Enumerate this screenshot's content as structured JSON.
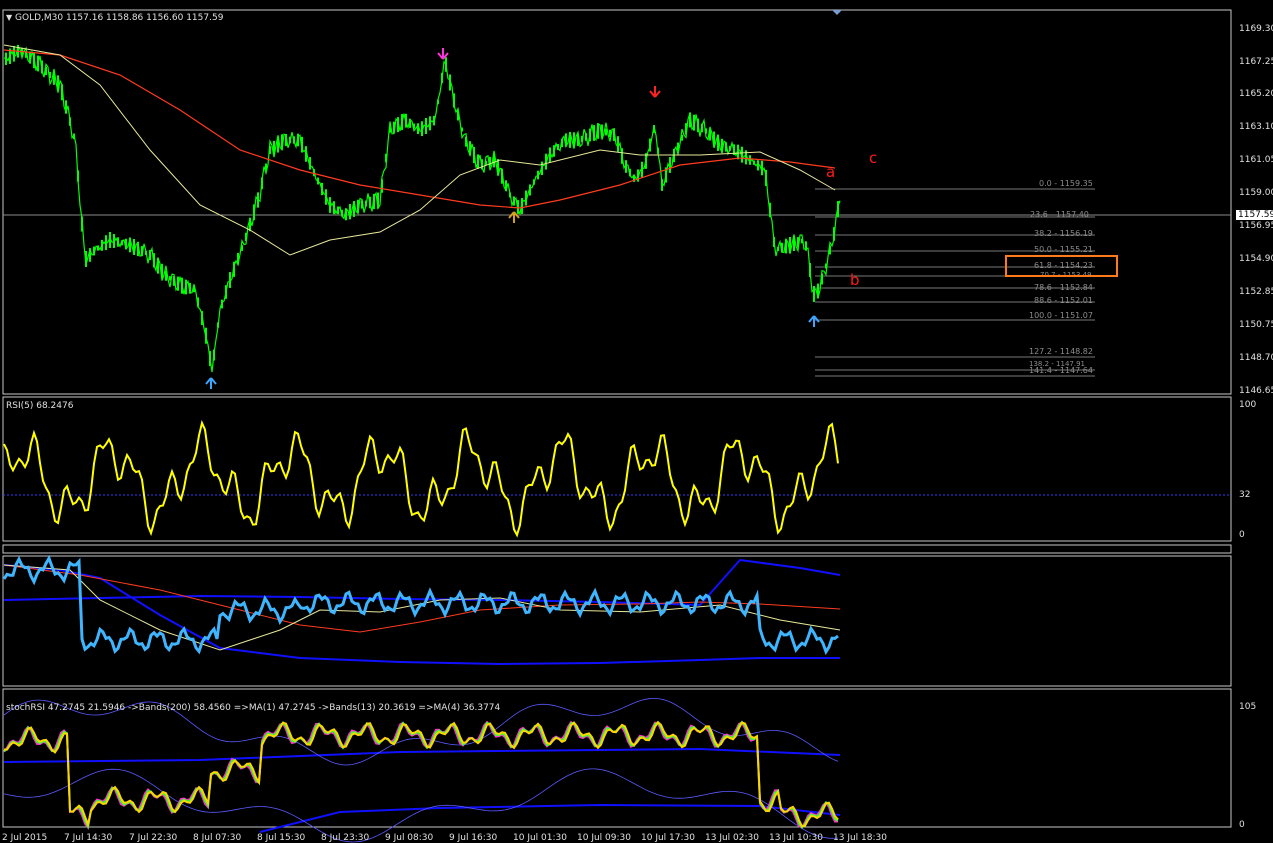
{
  "symbol_header": "GOLD,M30  1157.16 1158.86 1156.60 1157.59",
  "rsi_header": "RSI(5) 68.2476",
  "stoch_header": "stochRSI 47.2745 21.5946  ->Bands(200) 58.4560  =>MA(1) 47.2745  ->Bands(13) 20.3619  =>MA(4) 36.3774",
  "current_price": "1157.59",
  "price_axis": [
    "1169.30",
    "1167.25",
    "1165.20",
    "1163.10",
    "1161.05",
    "1159.00",
    "1156.95",
    "1154.90",
    "1152.85",
    "1150.75",
    "1148.70",
    "1146.65"
  ],
  "rsi_axis": [
    "100",
    "32",
    "0"
  ],
  "stoch_axis": [
    "105",
    "0"
  ],
  "time_axis": [
    "2 Jul 2015",
    "7 Jul 14:30",
    "7 Jul 22:30",
    "8 Jul 07:30",
    "8 Jul 15:30",
    "8 Jul 23:30",
    "9 Jul 08:30",
    "9 Jul 16:30",
    "10 Jul 01:30",
    "10 Jul 09:30",
    "10 Jul 17:30",
    "13 Jul 02:30",
    "13 Jul 10:30",
    "13 Jul 18:30"
  ],
  "fib_levels": [
    {
      "ratio": "0.0",
      "price": "1159.35"
    },
    {
      "ratio": "23.6",
      "price": "1157.40"
    },
    {
      "ratio": "38.2",
      "price": "1156.19"
    },
    {
      "ratio": "50.0",
      "price": "1155.21"
    },
    {
      "ratio": "61.8",
      "price": "1154.23"
    },
    {
      "ratio": "70.7",
      "price": "1153.49"
    },
    {
      "ratio": "78.6",
      "price": "1152.84"
    },
    {
      "ratio": "88.6",
      "price": "1152.01"
    },
    {
      "ratio": "100.0",
      "price": "1151.07"
    },
    {
      "ratio": "127.2",
      "price": "1148.82"
    },
    {
      "ratio": "138.2",
      "price": "1147.91"
    },
    {
      "ratio": "141.4",
      "price": "1147.64"
    }
  ],
  "wave_labels": {
    "a": "a",
    "b": "b",
    "c": "c"
  },
  "colors": {
    "candles": "#00ff00",
    "rsi": "#ffff00",
    "fast_ma": "#ff3b1f",
    "slow_ma": "#e8e89a",
    "aux_line": "#3fb5ff",
    "band": "#1010ff",
    "stoch_k": "#ffd400",
    "stoch_d": "#33ff33",
    "stoch_ma": "#ff33cc",
    "highlight": "#ff7a1a"
  },
  "icons": [
    "arrow-up-icon",
    "arrow-down-icon",
    "dropdown-triangle-icon"
  ]
}
